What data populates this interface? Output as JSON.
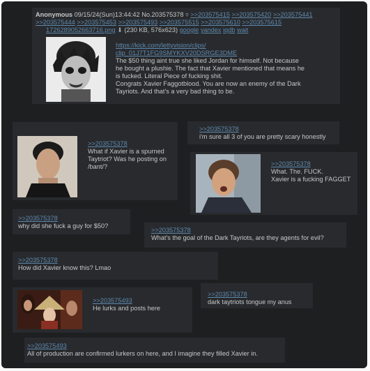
{
  "op": {
    "name": "Anonymous",
    "datetime": "09/15/24(Sun)13:44:42",
    "postno": "No.203575378",
    "arrow": "▿",
    "backlinks": [
      ">>203575415",
      ">>203575420",
      ">>203575441",
      ">>203575444",
      ">>203575453",
      ">>203575493",
      ">>203575515",
      ">>203575610",
      ">>203575615"
    ],
    "file_name": "1726289052663716.png",
    "download_icon": "download-icon",
    "file_info": "(230 KB, 576x623)",
    "search_links": [
      "google",
      "yandex",
      "iqdb",
      "wait"
    ],
    "link_lines": [
      "https://kick.com/lettyvision/clips/",
      "clip_01J7T1FG9SMYKXV20DSRGE3DME"
    ],
    "text_lines": [
      "The $50 thing aint true she liked Jordan for himself.  Not because",
      "he bought a plushie. The fact that Xavier mentioned that means he",
      "is fucked. Literal Piece of fucking shit.",
      "Congrats Xavier Faggotblood. You are now an enemy of the Dark",
      "Tayriots. And that's a very bad thing to be."
    ]
  },
  "replies": [
    {
      "quote": ">>203575378",
      "lines": [
        "What if Xavier is a spurned",
        "Taytriot? Was he posting on",
        "/bant/?"
      ]
    },
    {
      "quote": ">>203575378",
      "lines": [
        "i'm sure all 3 of you are pretty scary honestly"
      ]
    },
    {
      "quote": ">>203575378",
      "lines": [
        "What. The. FUCK.",
        "Xavier is a fucking FAGGET"
      ]
    },
    {
      "quote": ">>203575378",
      "lines": [
        "why did she fuck a guy for $50?"
      ]
    },
    {
      "quote": ">>203575378",
      "lines": [
        "What's the goal of the Dark Tayriots, are they agents for evil?"
      ]
    },
    {
      "quote": ">>203575378",
      "lines": [
        "How did Xavier know this? Lmao"
      ]
    },
    {
      "quote": ">>203575493",
      "lines": [
        "He lurks and posts here"
      ]
    },
    {
      "quote": ">>203575378",
      "lines": [
        "dark taytriots tongue my anus"
      ]
    },
    {
      "quote": ">>203575493",
      "lines": [
        "All of production are confirmed lurkers on here, and I imagine they filled Xavier in."
      ]
    }
  ]
}
